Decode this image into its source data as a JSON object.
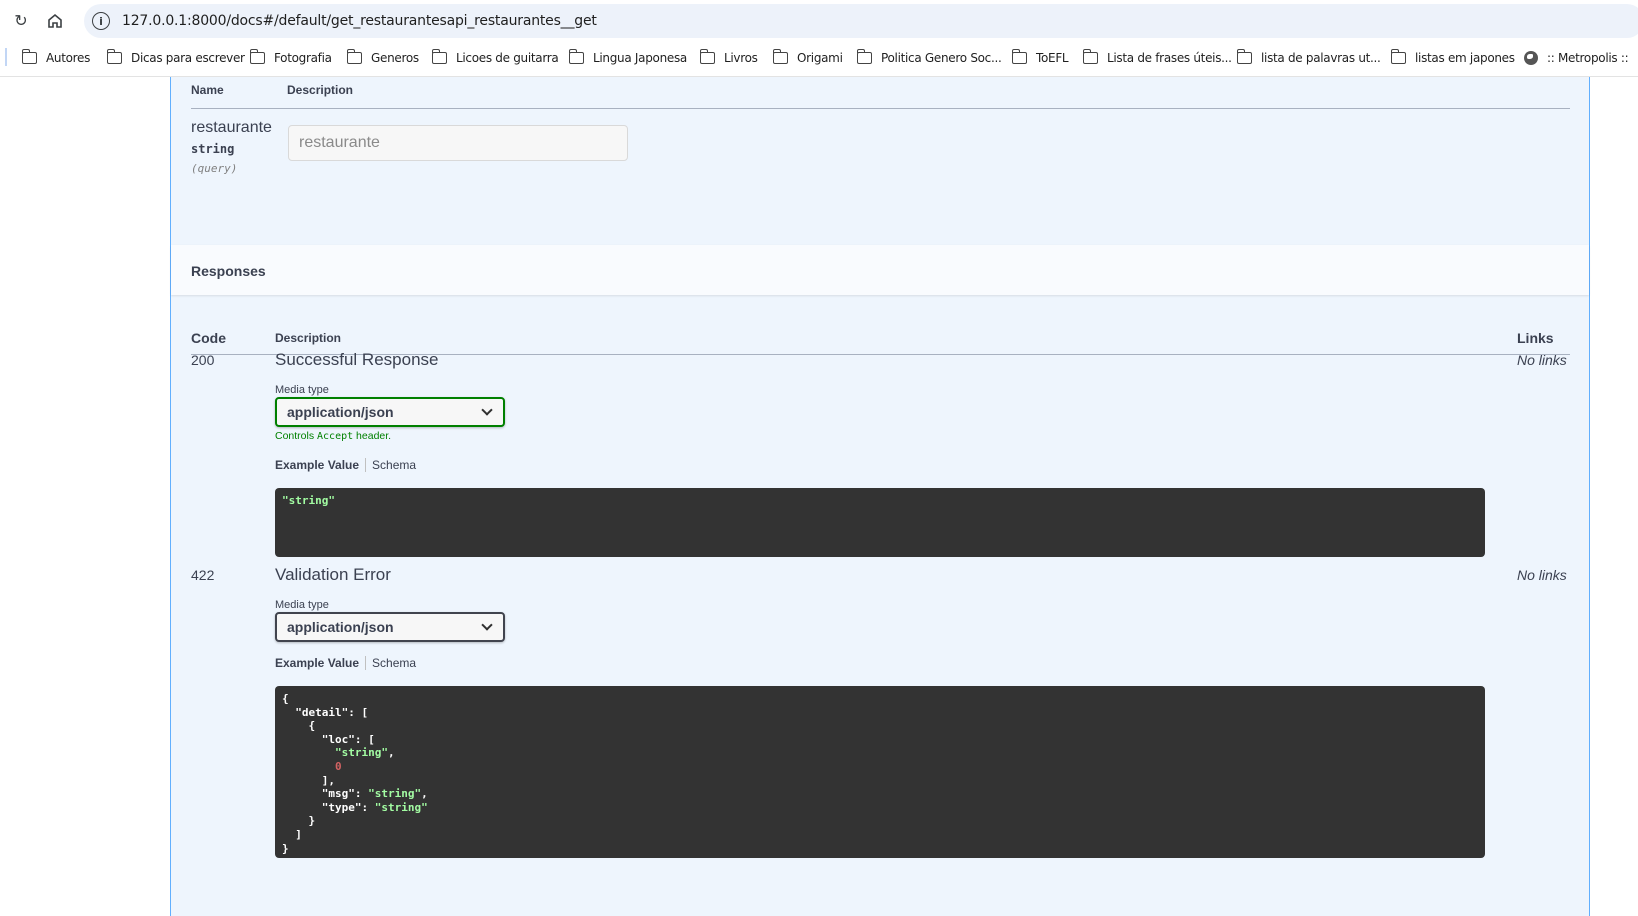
{
  "browser": {
    "url": "127.0.0.1:8000/docs#/default/get_restaurantesapi_restaurantes__get",
    "bookmarks": [
      {
        "label": "Autores",
        "icon": "folder-icon"
      },
      {
        "label": "Dicas para escrever",
        "icon": "folder-icon"
      },
      {
        "label": "Fotografia",
        "icon": "folder-icon"
      },
      {
        "label": "Generos",
        "icon": "folder-icon"
      },
      {
        "label": "Licoes de guitarra",
        "icon": "folder-icon"
      },
      {
        "label": "Lingua Japonesa",
        "icon": "folder-icon"
      },
      {
        "label": "Livros",
        "icon": "folder-icon"
      },
      {
        "label": "Origami",
        "icon": "folder-icon"
      },
      {
        "label": "Politica Genero Soc...",
        "icon": "folder-icon"
      },
      {
        "label": "ToEFL",
        "icon": "folder-icon"
      },
      {
        "label": "Lista de frases úteis...",
        "icon": "folder-icon"
      },
      {
        "label": "lista de palavras ut...",
        "icon": "folder-icon"
      },
      {
        "label": "listas em japones",
        "icon": "folder-icon"
      },
      {
        "label": ":: Metropolis ::",
        "icon": "globe-icon"
      }
    ]
  },
  "parameters": {
    "headers": {
      "name": "Name",
      "description": "Description"
    },
    "items": [
      {
        "name": "restaurante",
        "type": "string",
        "in": "(query)",
        "placeholder": "restaurante",
        "value": ""
      }
    ]
  },
  "responses": {
    "title": "Responses",
    "headers": {
      "code": "Code",
      "description": "Description",
      "links": "Links"
    },
    "items": [
      {
        "code": "200",
        "description": "Successful Response",
        "links": "No links",
        "media_label": "Media type",
        "media_type": "application/json",
        "controls_prefix": "Controls ",
        "controls_code": "Accept",
        "controls_suffix": " header.",
        "tab_example": "Example Value",
        "tab_schema": "Schema",
        "example": "\"string\""
      },
      {
        "code": "422",
        "description": "Validation Error",
        "links": "No links",
        "media_label": "Media type",
        "media_type": "application/json",
        "tab_example": "Example Value",
        "tab_schema": "Schema",
        "example": "{\n  \"detail\": [\n    {\n      \"loc\": [\n        \"string\",\n        0\n      ],\n      \"msg\": \"string\",\n      \"type\": \"string\"\n    }\n  ]\n}"
      }
    ]
  },
  "colors": {
    "accent_get": "#61affe",
    "string_token": "#a2fca2",
    "number_token": "#d36363",
    "accept_green": "#008000"
  }
}
